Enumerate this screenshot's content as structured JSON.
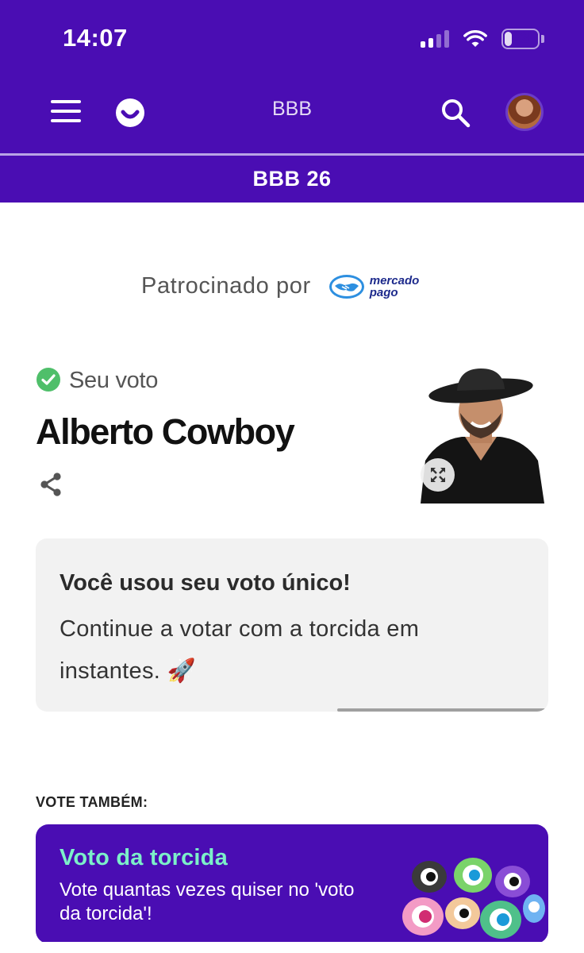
{
  "status_bar": {
    "time": "14:07",
    "battery": "23",
    "battery_level": 0.23,
    "icons": [
      "signal-icon",
      "wifi-icon",
      "battery-icon"
    ]
  },
  "header": {
    "title": "BBB",
    "section_title": "BBB 26",
    "icons": [
      "menu-icon",
      "smile-icon",
      "search-icon",
      "avatar"
    ]
  },
  "sponsor": {
    "label": "Patrocinado por",
    "logo_text_1": "mercado",
    "logo_text_2": "pago"
  },
  "vote": {
    "status_label": "Seu voto",
    "candidate": "Alberto Cowboy"
  },
  "info_card": {
    "title": "Você usou seu voto único!",
    "text": "Continue a votar com a torcida em instantes. 🚀"
  },
  "also_vote": {
    "label": "VOTE TAMBÉM:",
    "card_title": "Voto da torcida",
    "card_text": "Vote quantas vezes quiser no 'voto da torcida'!"
  },
  "colors": {
    "brand_purple": "#4a0db3",
    "accent_green": "#7cf0c9",
    "check_green": "#4fbf6a"
  }
}
